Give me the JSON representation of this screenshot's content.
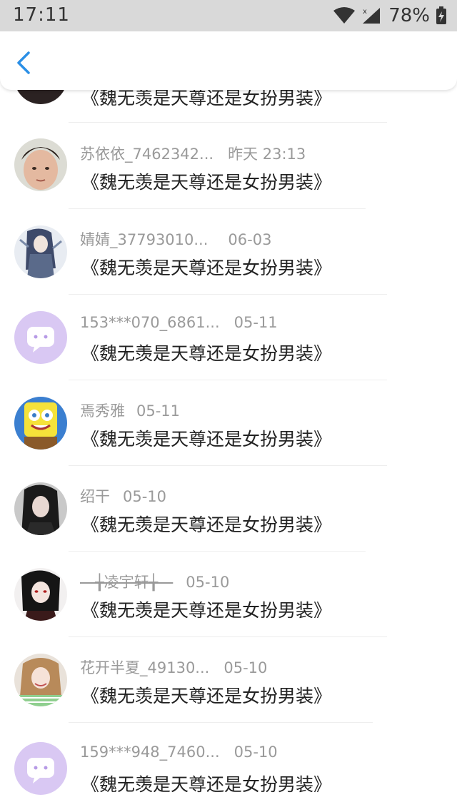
{
  "status_bar": {
    "time": "17:11",
    "battery": "78%"
  },
  "comments": [
    {
      "user": "",
      "date": "",
      "text": "《魏无羡是天尊还是女扮男装》",
      "avatar": "dark-avatar"
    },
    {
      "user": "苏依依_7462342...",
      "date": "昨天 23:13",
      "text": "《魏无羡是天尊还是女扮男装》",
      "avatar": "girl-photo"
    },
    {
      "user": "婧婧_37793010...",
      "date": "06-03",
      "text": "《魏无羡是天尊还是女扮男装》",
      "avatar": "anime-warrior"
    },
    {
      "user": "153***070_6861...",
      "date": "05-11",
      "text": "《魏无羡是天尊还是女扮男装》",
      "avatar": "default-chat"
    },
    {
      "user": "焉秀雅",
      "date": "05-11",
      "text": "《魏无羡是天尊还是女扮男装》",
      "avatar": "spongebob"
    },
    {
      "user": "绍干",
      "date": "05-10",
      "text": "《魏无羡是天尊还是女扮男装》",
      "avatar": "gothic-girl"
    },
    {
      "user": "—╁凌宇轩╁—",
      "date": "05-10",
      "text": "《魏无羡是天尊还是女扮男装》",
      "avatar": "anime-red-eyes"
    },
    {
      "user": "花开半夏_49130...",
      "date": "05-10",
      "text": "《魏无羡是天尊还是女扮男装》",
      "avatar": "smiling-girl"
    },
    {
      "user": "159***948_7460...",
      "date": "05-10",
      "text": "《魏无羡是天尊还是女扮男装》",
      "avatar": "default-chat"
    }
  ]
}
